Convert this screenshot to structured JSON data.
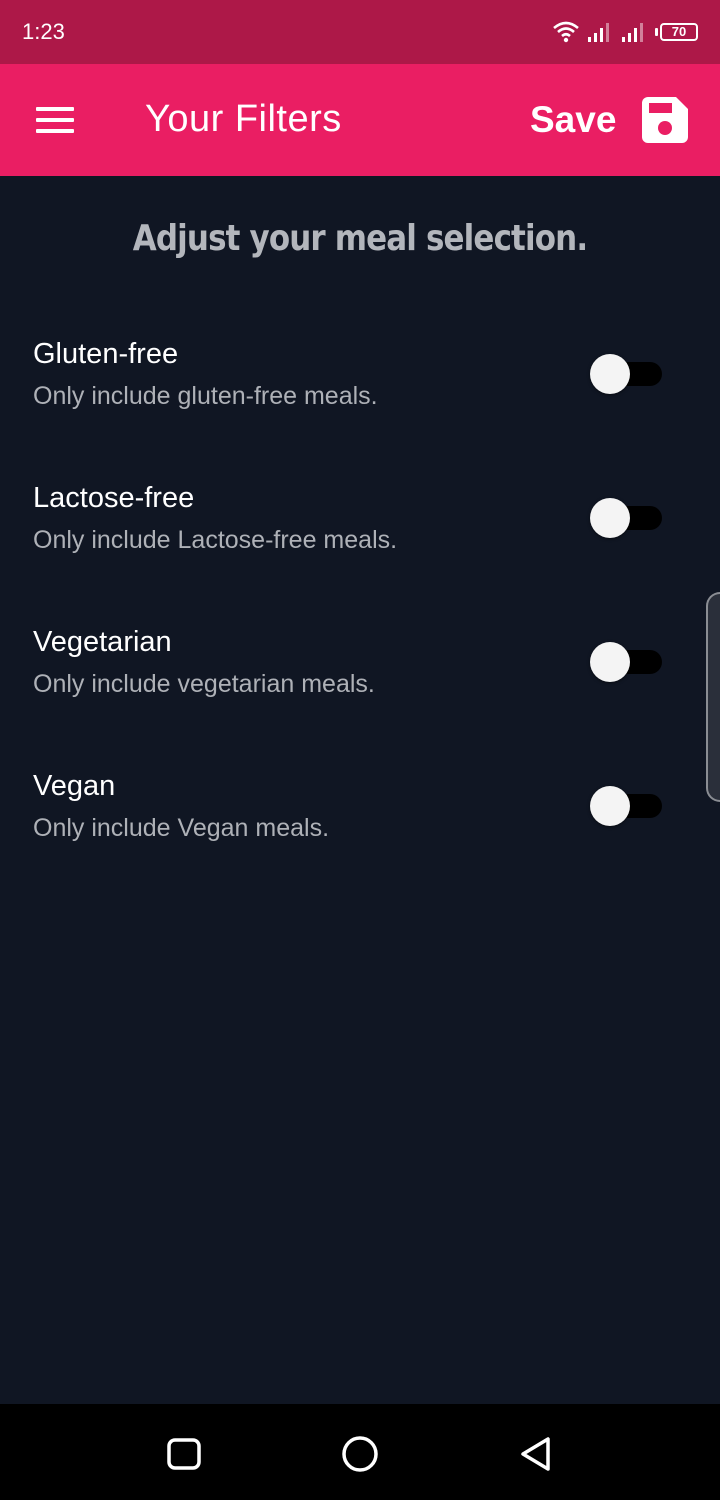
{
  "status_bar": {
    "time": "1:23",
    "battery": "70",
    "icons": [
      "wifi-icon",
      "signal-icon",
      "signal-icon",
      "battery-icon"
    ]
  },
  "app_bar": {
    "title": "Your Filters",
    "save_label": "Save",
    "color": "#ea1e63",
    "icons": [
      "menu-icon",
      "floppy-disk-icon"
    ]
  },
  "main": {
    "heading": "Adjust your meal selection.",
    "filters": [
      {
        "title": "Gluten-free",
        "subtitle": "Only include gluten-free meals.",
        "enabled": false
      },
      {
        "title": "Lactose-free",
        "subtitle": "Only include Lactose-free meals.",
        "enabled": false
      },
      {
        "title": "Vegetarian",
        "subtitle": "Only include vegetarian meals.",
        "enabled": false
      },
      {
        "title": "Vegan",
        "subtitle": "Only include Vegan meals.",
        "enabled": false
      }
    ]
  },
  "nav_bar": {
    "icons": [
      "recents-square-icon",
      "home-circle-icon",
      "back-triangle-icon"
    ]
  }
}
